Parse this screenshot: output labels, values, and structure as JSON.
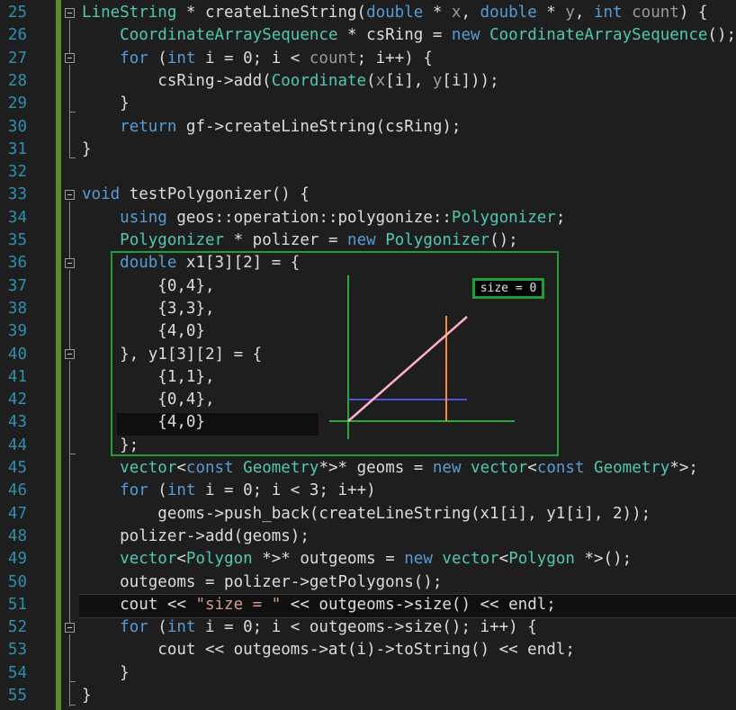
{
  "editor": {
    "line_numbers": [
      "25",
      "26",
      "27",
      "28",
      "29",
      "30",
      "31",
      "32",
      "33",
      "34",
      "35",
      "36",
      "37",
      "38",
      "39",
      "40",
      "41",
      "42",
      "43",
      "44",
      "45",
      "46",
      "47",
      "48",
      "49",
      "50",
      "51",
      "52",
      "53",
      "54",
      "55"
    ]
  },
  "code_lines": [
    [
      {
        "t": "LineString",
        "c": "ty"
      },
      {
        "t": " * createLineString("
      },
      {
        "t": "double",
        "c": "kw"
      },
      {
        "t": " * "
      },
      {
        "t": "x",
        "c": "pa"
      },
      {
        "t": ", "
      },
      {
        "t": "double",
        "c": "kw"
      },
      {
        "t": " * "
      },
      {
        "t": "y",
        "c": "pa"
      },
      {
        "t": ", "
      },
      {
        "t": "int",
        "c": "kw"
      },
      {
        "t": " "
      },
      {
        "t": "count",
        "c": "pa"
      },
      {
        "t": ") {"
      }
    ],
    [
      {
        "t": "    "
      },
      {
        "t": "CoordinateArraySequence",
        "c": "ty"
      },
      {
        "t": " * csRing = "
      },
      {
        "t": "new",
        "c": "kw"
      },
      {
        "t": " "
      },
      {
        "t": "CoordinateArraySequence",
        "c": "ty"
      },
      {
        "t": "();"
      }
    ],
    [
      {
        "t": "    "
      },
      {
        "t": "for",
        "c": "kw"
      },
      {
        "t": " ("
      },
      {
        "t": "int",
        "c": "kw"
      },
      {
        "t": " i = 0; i < "
      },
      {
        "t": "count",
        "c": "pa"
      },
      {
        "t": "; i++) {"
      }
    ],
    [
      {
        "t": "        csRing->add("
      },
      {
        "t": "Coordinate",
        "c": "ty"
      },
      {
        "t": "("
      },
      {
        "t": "x",
        "c": "pa"
      },
      {
        "t": "[i], "
      },
      {
        "t": "y",
        "c": "pa"
      },
      {
        "t": "[i]));"
      }
    ],
    [
      {
        "t": "    }"
      }
    ],
    [
      {
        "t": "    "
      },
      {
        "t": "return",
        "c": "kw"
      },
      {
        "t": " gf->createLineString(csRing);"
      }
    ],
    [
      {
        "t": "}"
      }
    ],
    [
      {
        "t": ""
      }
    ],
    [
      {
        "t": "void",
        "c": "kw"
      },
      {
        "t": " testPolygonizer() {"
      }
    ],
    [
      {
        "t": "    "
      },
      {
        "t": "using",
        "c": "kw"
      },
      {
        "t": " geos::operation::polygonize::"
      },
      {
        "t": "Polygonizer",
        "c": "ty"
      },
      {
        "t": ";"
      }
    ],
    [
      {
        "t": "    "
      },
      {
        "t": "Polygonizer",
        "c": "ty"
      },
      {
        "t": " * polizer = "
      },
      {
        "t": "new",
        "c": "kw"
      },
      {
        "t": " "
      },
      {
        "t": "Polygonizer",
        "c": "ty"
      },
      {
        "t": "();"
      }
    ],
    [
      {
        "t": "    "
      },
      {
        "t": "double",
        "c": "kw"
      },
      {
        "t": " x1[3][2] = {"
      }
    ],
    [
      {
        "t": "        {0,4},"
      }
    ],
    [
      {
        "t": "        {3,3},"
      }
    ],
    [
      {
        "t": "        {4,0}"
      }
    ],
    [
      {
        "t": "    }, y1[3][2] = {"
      }
    ],
    [
      {
        "t": "        {1,1},"
      }
    ],
    [
      {
        "t": "        {0,4},"
      }
    ],
    [
      {
        "t": "        {4,0}"
      }
    ],
    [
      {
        "t": "    };"
      }
    ],
    [
      {
        "t": "    "
      },
      {
        "t": "vector",
        "c": "ty"
      },
      {
        "t": "<"
      },
      {
        "t": "const",
        "c": "kw"
      },
      {
        "t": " "
      },
      {
        "t": "Geometry",
        "c": "ty"
      },
      {
        "t": "*>* geoms = "
      },
      {
        "t": "new",
        "c": "kw"
      },
      {
        "t": " "
      },
      {
        "t": "vector",
        "c": "ty"
      },
      {
        "t": "<"
      },
      {
        "t": "const",
        "c": "kw"
      },
      {
        "t": " "
      },
      {
        "t": "Geometry",
        "c": "ty"
      },
      {
        "t": "*>;"
      }
    ],
    [
      {
        "t": "    "
      },
      {
        "t": "for",
        "c": "kw"
      },
      {
        "t": " ("
      },
      {
        "t": "int",
        "c": "kw"
      },
      {
        "t": " i = 0; i < 3; i++)"
      }
    ],
    [
      {
        "t": "        geoms->push_back(createLineString(x1[i], y1[i], 2));"
      }
    ],
    [
      {
        "t": "    polizer->add(geoms);"
      }
    ],
    [
      {
        "t": "    "
      },
      {
        "t": "vector",
        "c": "ty"
      },
      {
        "t": "<"
      },
      {
        "t": "Polygon",
        "c": "ty"
      },
      {
        "t": " *>* outgeoms = "
      },
      {
        "t": "new",
        "c": "kw"
      },
      {
        "t": " "
      },
      {
        "t": "vector",
        "c": "ty"
      },
      {
        "t": "<"
      },
      {
        "t": "Polygon",
        "c": "ty"
      },
      {
        "t": " *>();"
      }
    ],
    [
      {
        "t": "    outgeoms = polizer->getPolygons();"
      }
    ],
    [
      {
        "t": "    cout << "
      },
      {
        "t": "\"size = \"",
        "c": "st"
      },
      {
        "t": " << outgeoms->size() << endl;"
      }
    ],
    [
      {
        "t": "    "
      },
      {
        "t": "for",
        "c": "kw"
      },
      {
        "t": " ("
      },
      {
        "t": "int",
        "c": "kw"
      },
      {
        "t": " i = 0; i < outgeoms->size(); i++) {"
      }
    ],
    [
      {
        "t": "        cout << outgeoms->at(i)->toString() << endl;"
      }
    ],
    [
      {
        "t": "    }"
      }
    ],
    [
      {
        "t": "}"
      }
    ]
  ],
  "overlay": {
    "size_label": "size = 0",
    "line_colors": {
      "green_axes": "#2aa83a",
      "orange": "#ff8c2a",
      "blue": "#5050d8",
      "pink": "#ffb0c8"
    }
  },
  "colors": {
    "background": "#1e1e1e",
    "keyword": "#569cd6",
    "type": "#4ec9b0",
    "param": "#9a9a9a",
    "string": "#d69d85",
    "line_number": "#2b91af",
    "highlight_box": "#1f9d3a"
  }
}
